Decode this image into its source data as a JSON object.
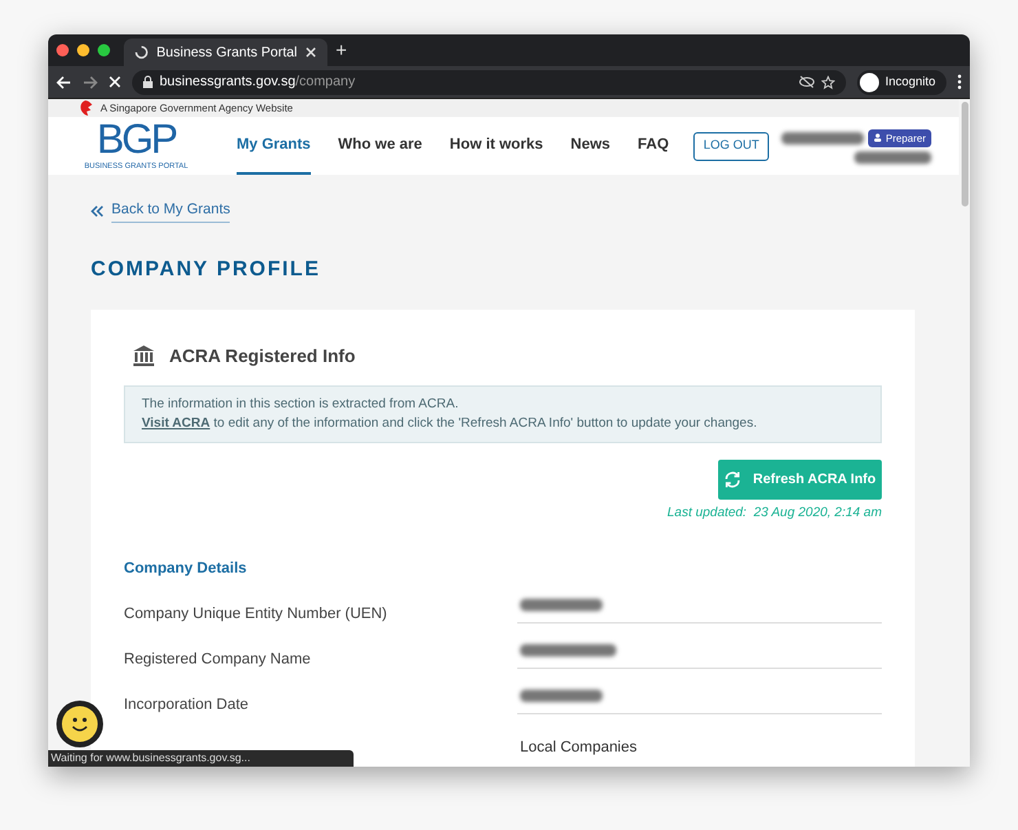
{
  "browser": {
    "tab_title": "Business Grants Portal",
    "new_tab": "+",
    "url_host": "businessgrants.gov.sg",
    "url_path": "/company",
    "profile": "Incognito",
    "loading": true
  },
  "gov_bar": {
    "text": "A Singapore Government Agency Website"
  },
  "header": {
    "logo": "BGP",
    "logo_caption": "BUSINESS GRANTS PORTAL",
    "nav": [
      {
        "label": "My Grants",
        "selected": true
      },
      {
        "label": "Who we are",
        "selected": false
      },
      {
        "label": "How it works",
        "selected": false
      },
      {
        "label": "News",
        "selected": false
      },
      {
        "label": "FAQ",
        "selected": false
      }
    ],
    "logout": "LOG OUT",
    "user": {
      "name_redacted": true,
      "role": "Preparer",
      "company_redacted": true
    }
  },
  "back_link": "Back to My Grants",
  "page_title": "COMPANY PROFILE",
  "card": {
    "title": "ACRA Registered Info",
    "notice": {
      "line_1": "The information in this section is extracted from ACRA.",
      "link": "Visit ACRA",
      "line_2": " to edit any of the information and click the 'Refresh ACRA Info' button to update your changes."
    },
    "refresh_button": "Refresh ACRA Info",
    "last_updated": "Last updated:  23 Aug 2020, 2:14 am",
    "section": "Company Details",
    "rows": [
      {
        "label": "Company Unique Entity Number (UEN)",
        "redacted": true
      },
      {
        "label": "Registered Company Name",
        "redacted": true
      },
      {
        "label": "Incorporation Date",
        "redacted": true
      },
      {
        "value": "Local Companies",
        "redacted": false
      }
    ]
  },
  "status_bubble": "Waiting for www.businessgrants.gov.sg..."
}
